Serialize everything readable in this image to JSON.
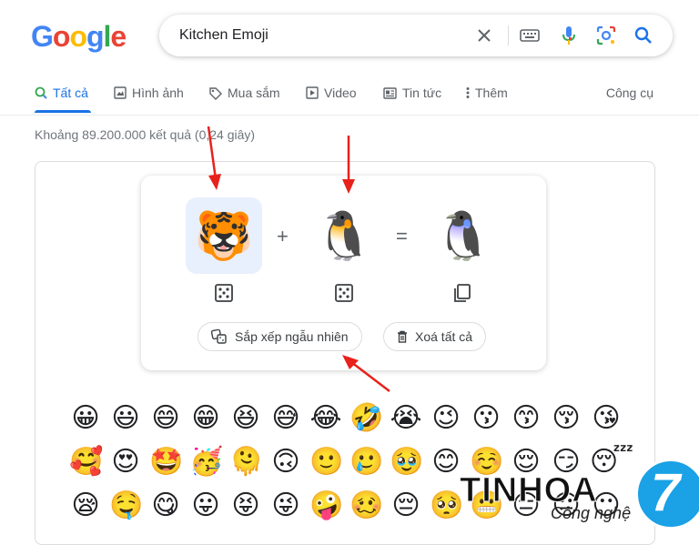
{
  "logo": {
    "text": "Google"
  },
  "search": {
    "query": "Kitchen Emoji"
  },
  "tabs": [
    {
      "label": "Tất cả"
    },
    {
      "label": "Hình ảnh"
    },
    {
      "label": "Mua sắm"
    },
    {
      "label": "Video"
    },
    {
      "label": "Tin tức"
    },
    {
      "label": "Thêm"
    }
  ],
  "tools_label": "Công cụ",
  "result_stats": "Khoảng 89.200.000 kết quả (0,24 giây)",
  "kitchen": {
    "left_emoji": "🐯",
    "plus": "+",
    "right_emoji": "🐧",
    "equals": "=",
    "result_emoji": "🐧",
    "shuffle_label": "Sắp xếp ngẫu nhiên",
    "clear_label": "Xoá tất cả"
  },
  "emoji_grid": [
    [
      "😀",
      "😃",
      "😄",
      "😁",
      "😆",
      "😅",
      "😂",
      "🤣",
      "😭",
      "😉",
      "😗",
      "😙",
      "😚",
      "😘"
    ],
    [
      "🥰",
      "😍",
      "🤩",
      "🥳",
      "🫠",
      "🙃",
      "🙂",
      "🥲",
      "🥹",
      "😊",
      "☺️",
      "😌",
      "😏",
      "😴"
    ],
    [
      "😪",
      "🤤",
      "😋",
      "😛",
      "😝",
      "😜",
      "🤪",
      "🥴",
      "😔",
      "🥺",
      "😬",
      "😑",
      "😐",
      "😶"
    ]
  ],
  "watermark": {
    "brand": "TINHOA",
    "sub": "Công nghệ",
    "number": "7"
  },
  "colors": {
    "accent": "#1a73e8",
    "arrow": "#e8211b"
  }
}
